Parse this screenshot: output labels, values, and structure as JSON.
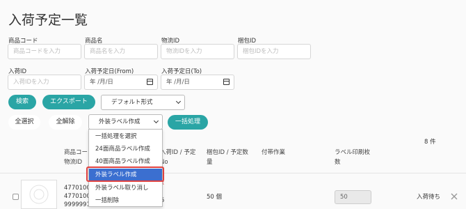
{
  "page": {
    "title": "入荷予定一覧"
  },
  "filters": {
    "product_code": {
      "label": "商品コード",
      "placeholder": "商品コードを入力"
    },
    "product_name": {
      "label": "商品名",
      "placeholder": "商品名を入力"
    },
    "logistics_id": {
      "label": "物流ID",
      "placeholder": "物流IDを入力"
    },
    "package_id": {
      "label": "梱包ID",
      "placeholder": "梱包IDを入力"
    },
    "arrival_id": {
      "label": "入荷ID",
      "placeholder": "入荷IDを入力"
    },
    "date_from": {
      "label": "入荷予定日(From)",
      "value": "年 /月/日"
    },
    "date_to": {
      "label": "入荷予定日(To)",
      "value": "年 /月/日"
    }
  },
  "actions": {
    "search_label": "検索",
    "export_label": "エクスポート",
    "format_select": "デフォルト形式",
    "select_all_label": "全選択",
    "deselect_all_label": "全解除",
    "bulk_select_value": "外装ラベル作成",
    "bulk_process_label": "一括処理"
  },
  "dropdown": {
    "options": [
      "一括処理を選択",
      "24面商品ラベル作成",
      "40面商品ラベル作成",
      "外装ラベル作成",
      "外装ラベル取り消し",
      "一括削除"
    ],
    "selected_index": 3
  },
  "table": {
    "count": "8 件",
    "headers": {
      "product_code_1": "商品コー",
      "logistics_id": "物流ID",
      "arrival_id_1": "入荷ID / 予定",
      "arrival_id_2": "No",
      "package_id_1": "梱包ID / 予定数",
      "package_id_2": "量",
      "attached_work": "付帯作業",
      "label_qty_1": "ラベル印刷枚",
      "label_qty_2": "数"
    },
    "rows": [
      {
        "code_lines": [
          "47701001",
          "47701001",
          "99999910"
        ],
        "arrival_fragment": "5",
        "quantity": "50 個",
        "label_count": "50",
        "status": "入荷待ち",
        "x_fragment": "x"
      }
    ]
  }
}
